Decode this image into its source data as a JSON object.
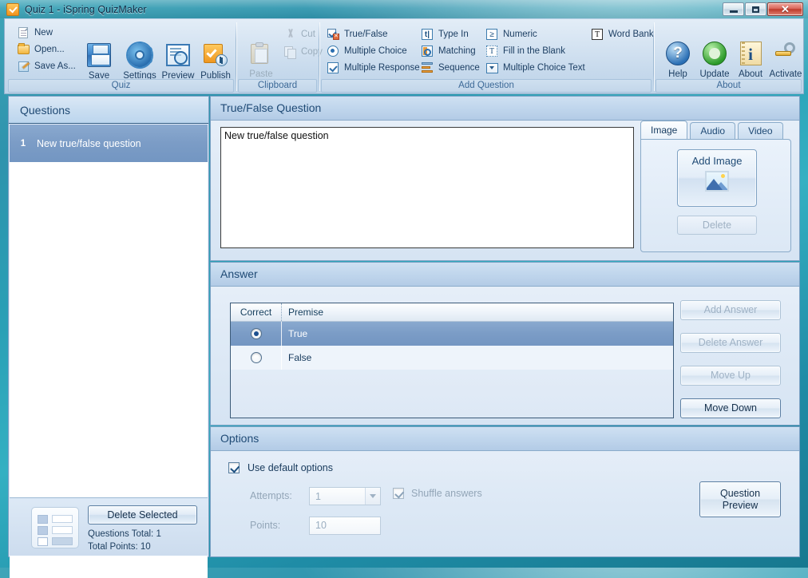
{
  "window": {
    "title": "Quiz 1 - iSpring QuizMaker",
    "app_icon": "quizmaker-checkmark-icon",
    "controls": {
      "minimize": "minimize-icon",
      "maximize": "maximize-icon",
      "close": "close-icon"
    }
  },
  "ribbon": {
    "groups": [
      {
        "title": "Quiz",
        "small_items": [
          {
            "label": "New",
            "icon": "new-document-icon"
          },
          {
            "label": "Open...",
            "icon": "open-folder-icon"
          },
          {
            "label": "Save As...",
            "icon": "save-as-icon"
          }
        ],
        "big_items": [
          {
            "label": "Save",
            "icon": "floppy-disk-icon"
          },
          {
            "label": "Settings",
            "icon": "gear-icon"
          },
          {
            "label": "Preview",
            "icon": "preview-magnifier-icon"
          },
          {
            "label": "Publish",
            "icon": "publish-icon"
          }
        ]
      },
      {
        "title": "Clipboard",
        "paste": {
          "label": "Paste",
          "icon": "paste-icon"
        },
        "small_items": [
          {
            "label": "Cut",
            "icon": "scissors-icon"
          },
          {
            "label": "Copy",
            "icon": "copy-icon"
          }
        ]
      },
      {
        "title": "Add Question",
        "col1": [
          {
            "label": "True/False",
            "icon": "true-false-icon"
          },
          {
            "label": "Multiple Choice",
            "icon": "radio-button-icon"
          },
          {
            "label": "Multiple Response",
            "icon": "checkbox-icon"
          }
        ],
        "col2": [
          {
            "label": "Type In",
            "icon": "text-cursor-icon"
          },
          {
            "label": "Matching",
            "icon": "matching-icon"
          },
          {
            "label": "Sequence",
            "icon": "sequence-icon"
          }
        ],
        "col3": [
          {
            "label": "Numeric",
            "icon": "greater-equal-icon"
          },
          {
            "label": "Fill in the Blank",
            "icon": "dotted-text-box-icon"
          },
          {
            "label": "Multiple Choice Text",
            "icon": "dropdown-icon"
          }
        ],
        "col4": [
          {
            "label": "Word Bank",
            "icon": "word-bank-icon"
          }
        ]
      },
      {
        "title": "About",
        "big_items": [
          {
            "label": "Help",
            "icon": "help-question-icon"
          },
          {
            "label": "Update",
            "icon": "update-refresh-icon"
          },
          {
            "label": "About",
            "icon": "about-info-icon"
          },
          {
            "label": "Activate",
            "icon": "activate-key-icon"
          }
        ]
      }
    ]
  },
  "questions_panel": {
    "header": "Questions",
    "items": [
      {
        "number": "1",
        "text": "New true/false question"
      }
    ],
    "thumbnail_icon": "question-list-thumbnail-icon",
    "delete_selected_label": "Delete Selected",
    "questions_total": "Questions Total: 1",
    "total_points": "Total Points: 10"
  },
  "question_section": {
    "header": "True/False Question",
    "text_value": "New true/false question",
    "media": {
      "tabs": [
        {
          "label": "Image",
          "active": true
        },
        {
          "label": "Audio",
          "active": false
        },
        {
          "label": "Video",
          "active": false
        }
      ],
      "add_label": "Add Image",
      "add_icon": "picture-icon",
      "delete_label": "Delete"
    }
  },
  "answer_section": {
    "header": "Answer",
    "columns": [
      "Correct",
      "Premise"
    ],
    "rows": [
      {
        "correct": true,
        "premise": "True",
        "selected": true
      },
      {
        "correct": false,
        "premise": "False",
        "selected": false
      }
    ],
    "buttons": [
      {
        "label": "Add Answer",
        "enabled": false
      },
      {
        "label": "Delete Answer",
        "enabled": false
      },
      {
        "label": "Move Up",
        "enabled": false
      },
      {
        "label": "Move Down",
        "enabled": true
      }
    ]
  },
  "options_section": {
    "header": "Options",
    "use_default_label": "Use default options",
    "use_default_checked": true,
    "attempts_label": "Attempts:",
    "attempts_value": "1",
    "shuffle_label": "Shuffle answers",
    "shuffle_checked": true,
    "points_label": "Points:",
    "points_value": "10",
    "question_preview_line1": "Question",
    "question_preview_line2": "Preview"
  },
  "colors": {
    "desktop": "#2aa0b6",
    "accent": "#2a6eb0",
    "selection": "#7b9cc6",
    "header_text": "#1f4a75",
    "close_button": "#bd3a2a"
  }
}
